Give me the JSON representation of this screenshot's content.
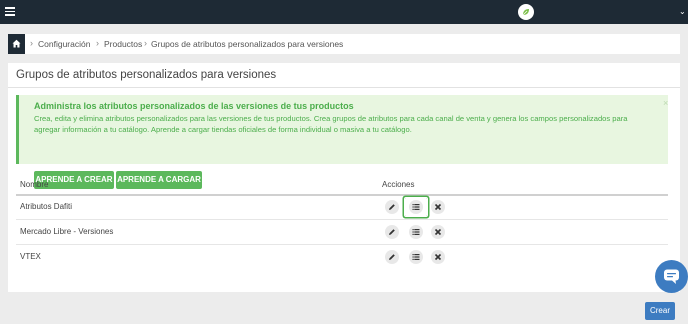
{
  "topbar": {
    "menu_icon": "hamburger-icon",
    "avatar_icon": "leaf-logo-icon",
    "caret_icon": "chevron-down-icon"
  },
  "breadcrumb": {
    "home_icon": "home-icon",
    "items": [
      "Configuración",
      "Productos",
      "Grupos de atributos personalizados para versiones"
    ],
    "separator": "›"
  },
  "panel": {
    "title": "Grupos de atributos personalizados para versiones",
    "alert": {
      "title": "Administra los atributos personalizados de las versiones de tus productos",
      "text": "Crea, edita y elimina atributos personalizados para las versiones de tus productos. Crea grupos de atributos para cada canal de venta y genera los campos personalizados para agregar información a tu catálogo. Aprende a cargar tiendas oficiales de forma individual o masiva a tu catálogo.",
      "close": "×",
      "buttons": [
        "APRENDE A CREAR",
        "APRENDE A CARGAR"
      ],
      "accent_color": "#5cb85c"
    },
    "table": {
      "headers": [
        "Nombre",
        "Acciones"
      ],
      "rows": [
        {
          "name": "Atributos Dafiti"
        },
        {
          "name": "Mercado Libre - Versiones"
        },
        {
          "name": "VTEX"
        }
      ],
      "action_icons": [
        "pencil-icon",
        "list-icon",
        "close-icon"
      ]
    }
  },
  "chat": {
    "icon": "chat-bubble-icon"
  },
  "create_button": {
    "label": "Crear",
    "color": "#3d7cc1"
  }
}
